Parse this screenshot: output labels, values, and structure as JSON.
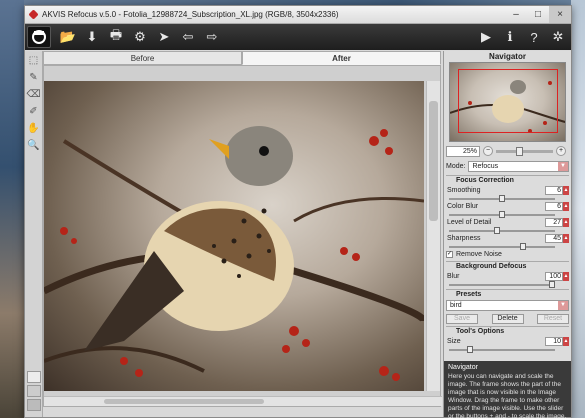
{
  "window": {
    "title": "AKVIS Refocus v.5.0 - Fotolia_12988724_Subscription_XL.jpg (RGB/8, 3504x2336)"
  },
  "window_controls": {
    "minimize": "–",
    "maximize": "□",
    "close": "×"
  },
  "toolbar": {
    "logo_icon": "akvis-logo-icon",
    "left_buttons": [
      {
        "name": "open-icon",
        "glyph": "📂"
      },
      {
        "name": "save-icon",
        "glyph": "⬇"
      },
      {
        "name": "print-icon",
        "glyph": "🖶"
      },
      {
        "name": "share-icon",
        "glyph": "⚙"
      },
      {
        "name": "refocus-icon",
        "glyph": "➤"
      },
      {
        "name": "undo-icon",
        "glyph": "⇦"
      },
      {
        "name": "redo-icon",
        "glyph": "⇨"
      }
    ],
    "right_buttons": [
      {
        "name": "run-icon",
        "glyph": "▶"
      },
      {
        "name": "info-icon",
        "glyph": "ℹ"
      },
      {
        "name": "help-icon",
        "glyph": "?"
      },
      {
        "name": "settings-icon",
        "glyph": "✲"
      }
    ]
  },
  "tabs": [
    {
      "label": "Before",
      "active": false
    },
    {
      "label": "After",
      "active": true
    }
  ],
  "navigator": {
    "title": "Navigator",
    "zoom": "25%",
    "zoom_minus": "−",
    "zoom_plus": "+"
  },
  "mode": {
    "label": "Mode:",
    "value": "Refocus"
  },
  "focus_correction": {
    "title": "Focus Correction",
    "params": [
      {
        "label": "Smoothing",
        "value": "6",
        "fraction": 0.5
      },
      {
        "label": "Color Blur",
        "value": "6",
        "fraction": 0.5
      },
      {
        "label": "Level of Detail",
        "value": "27",
        "fraction": 0.45
      },
      {
        "label": "Sharpness",
        "value": "45",
        "fraction": 0.7
      }
    ],
    "remove_noise": {
      "label": "Remove Noise",
      "checked": true
    }
  },
  "background_defocus": {
    "title": "Background Defocus",
    "blur": {
      "label": "Blur",
      "value": "100",
      "fraction": 1.0
    }
  },
  "presets": {
    "title": "Presets",
    "value": "bird",
    "save": "Save",
    "delete": "Delete",
    "reset": "Reset"
  },
  "tools_options": {
    "title": "Tool's Options",
    "size": {
      "label": "Size",
      "value": "10",
      "fraction": 0.2
    }
  },
  "hint": {
    "title": "Navigator",
    "text": "Here you can navigate and scale the image. The frame shows the part of the image that is now visible in the Image Window. Drag the frame to make other parts of the image visible. Use the slider or the buttons + and - to scale the image."
  },
  "colors": {
    "accent": "#c62828",
    "toolbar": "#2a2a2a",
    "panel": "#dcdcdc"
  }
}
